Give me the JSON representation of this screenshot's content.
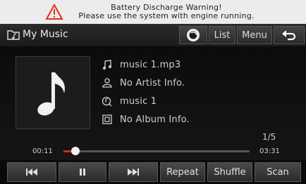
{
  "warning": {
    "line1": "Battery Discharge Warning!",
    "line2": "Please use the system with engine running."
  },
  "titlebar": {
    "title": "My Music",
    "buttons": {
      "list": "List",
      "menu": "Menu"
    }
  },
  "track": {
    "file": "music 1.mp3",
    "artist": "No Artist Info.",
    "title": "music 1",
    "album": "No Album Info."
  },
  "playback": {
    "track_count": "1/5",
    "elapsed": "00:11",
    "total": "03:31",
    "progress": 0.063
  },
  "controls": {
    "repeat": "Repeat",
    "shuffle": "Shuffle",
    "scan": "Scan"
  },
  "colors": {
    "progress": "#e02020",
    "warning_icon": "#e03020"
  }
}
